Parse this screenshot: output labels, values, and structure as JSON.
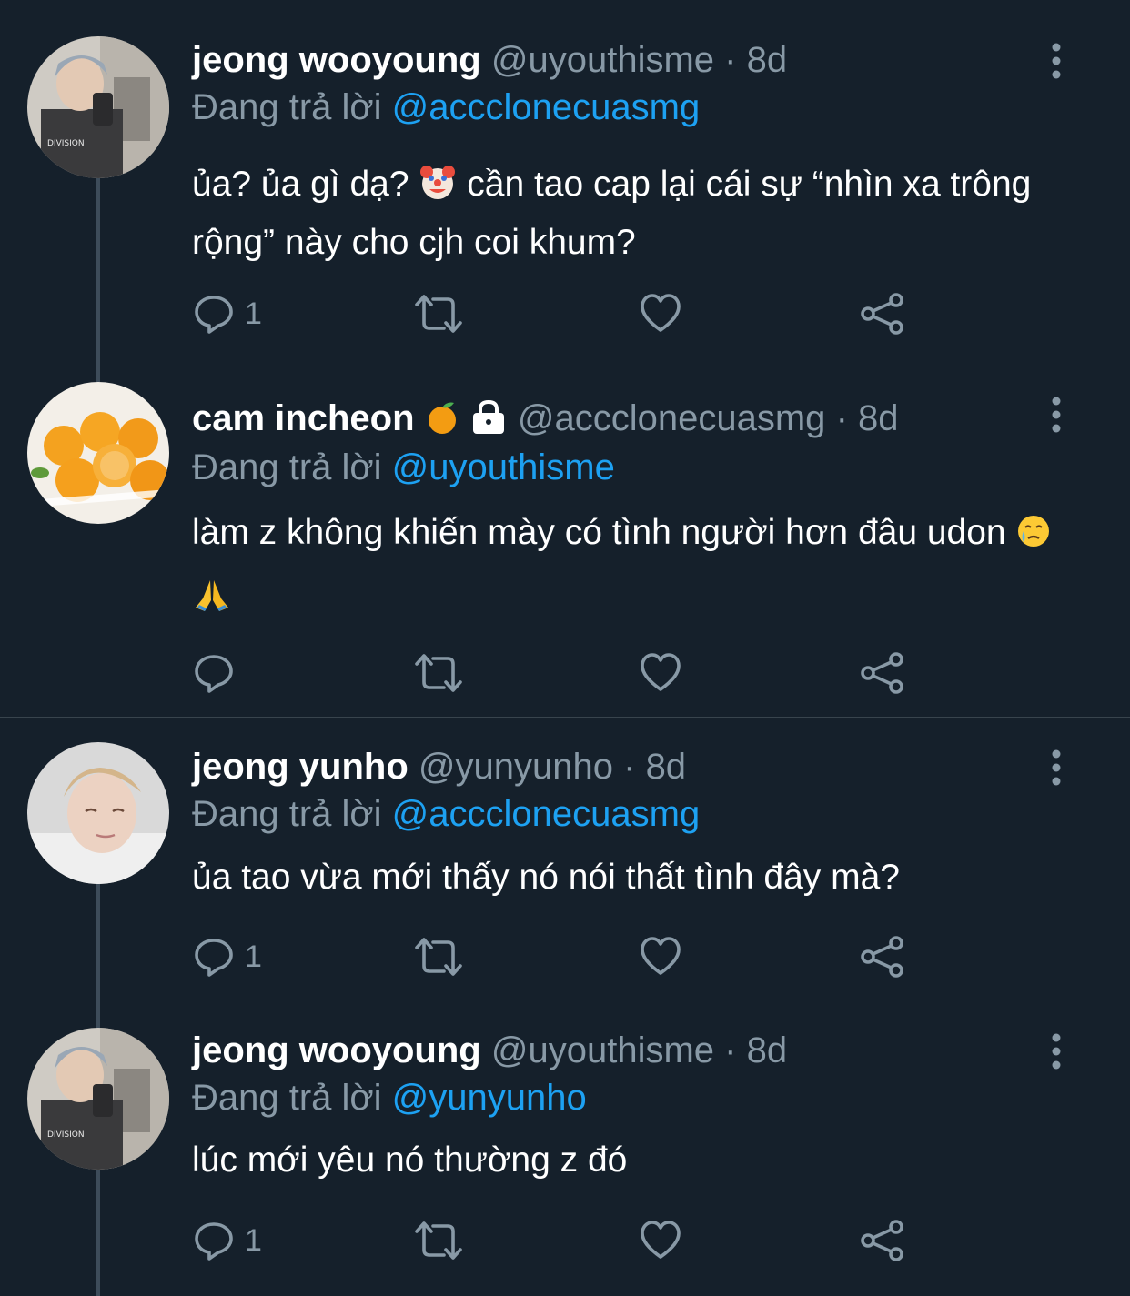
{
  "colors": {
    "background": "#15202b",
    "secondary_text": "#8899a6",
    "accent": "#1da1f2",
    "thread_line": "#3d4c5a",
    "divider": "#38444d"
  },
  "tweets": [
    {
      "display_name": "jeong wooyoung",
      "handle": "@uyouthisme",
      "separator": "·",
      "time": "8d",
      "reply_prefix": "Đang trả lời",
      "reply_to": "@accclonecuasmg",
      "text_before_emoji": "ủa? ủa gì dạ?",
      "emoji": "clown-face",
      "text_after_emoji": "cần tao cap lại cái sự “nhìn xa trông rộng” này cho cjh coi khum?",
      "reply_count": "1",
      "icons": [
        "reply-icon",
        "retweet-icon",
        "like-icon",
        "share-icon",
        "more-icon"
      ]
    },
    {
      "display_name": "cam incheon",
      "name_emoji": "tangerine",
      "name_badge": "lock",
      "handle": "@accclonecuasmg",
      "separator": "·",
      "time": "8d",
      "reply_prefix": "Đang trả lời",
      "reply_to": "@uyouthisme",
      "text": "làm z không khiến mày có tình người hơn đâu udon",
      "text_emojis": [
        "crying-face",
        "folded-hands"
      ],
      "reply_count": "",
      "icons": [
        "reply-icon",
        "retweet-icon",
        "like-icon",
        "share-icon",
        "more-icon"
      ]
    },
    {
      "display_name": "jeong yunho",
      "handle": "@yunyunho",
      "separator": "·",
      "time": "8d",
      "reply_prefix": "Đang trả lời",
      "reply_to": "@accclonecuasmg",
      "text": "ủa tao vừa mới thấy nó nói thất tình đây mà?",
      "reply_count": "1",
      "icons": [
        "reply-icon",
        "retweet-icon",
        "like-icon",
        "share-icon",
        "more-icon"
      ]
    },
    {
      "display_name": "jeong wooyoung",
      "handle": "@uyouthisme",
      "separator": "·",
      "time": "8d",
      "reply_prefix": "Đang trả lời",
      "reply_to": "@yunyunho",
      "text": "lúc mới yêu nó thường z đó",
      "reply_count": "1",
      "icons": [
        "reply-icon",
        "retweet-icon",
        "like-icon",
        "share-icon",
        "more-icon"
      ]
    }
  ]
}
